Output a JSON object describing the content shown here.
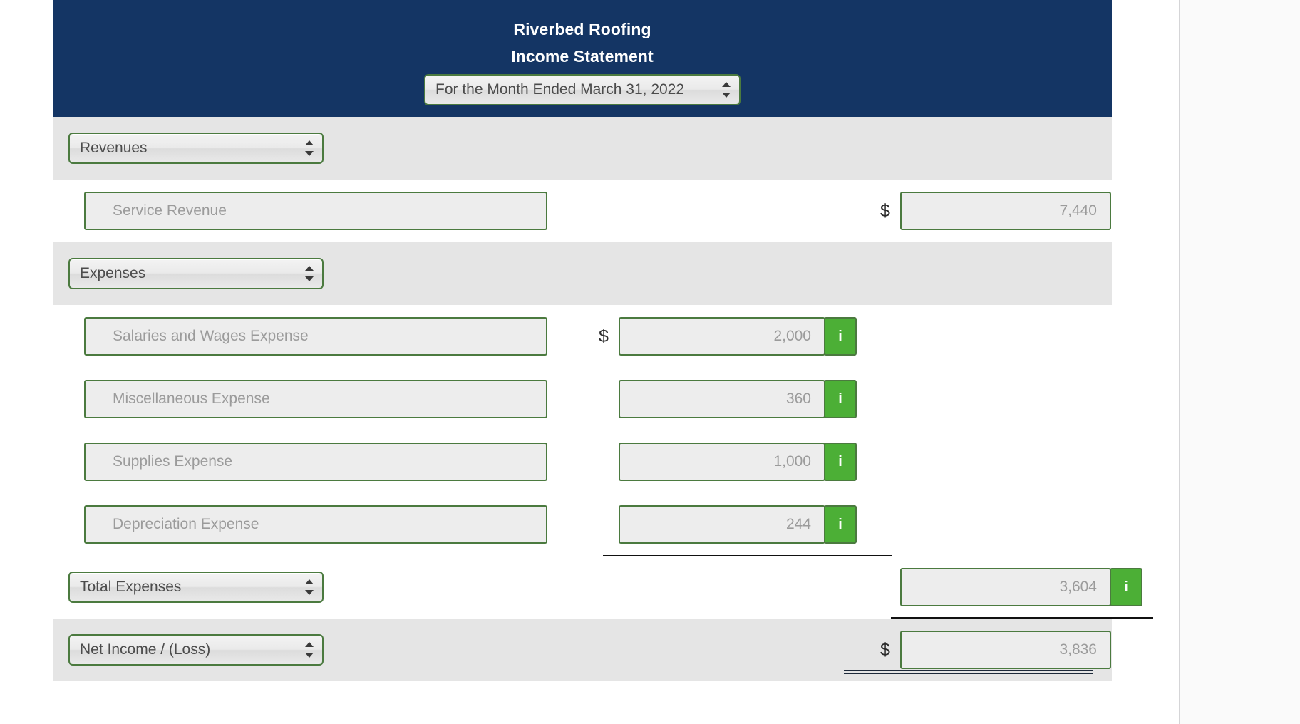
{
  "header": {
    "company": "Riverbed Roofing",
    "statement_title": "Income Statement",
    "period_select": "For the Month Ended March 31, 2022",
    "bg_color": "#143564"
  },
  "theme": {
    "header_blue": "#143564",
    "field_border_green": "#4b7a3f",
    "info_button_green": "#4caf36",
    "section_band": "#e5e5e5",
    "field_fill": "#ededed",
    "placeholder_text": "#9b9b9b"
  },
  "sections": {
    "revenues": {
      "select_label": "Revenues",
      "lines": [
        {
          "account": "Service Revenue",
          "currency": "$",
          "amount": "7,440",
          "has_info": false
        }
      ]
    },
    "expenses": {
      "select_label": "Expenses",
      "lines": [
        {
          "account": "Salaries and Wages Expense",
          "currency": "$",
          "amount": "2,000",
          "has_info": true,
          "info_label": "i"
        },
        {
          "account": "Miscellaneous Expense",
          "currency": "",
          "amount": "360",
          "has_info": true,
          "info_label": "i"
        },
        {
          "account": "Supplies Expense",
          "currency": "",
          "amount": "1,000",
          "has_info": true,
          "info_label": "i"
        },
        {
          "account": "Depreciation Expense",
          "currency": "",
          "amount": "244",
          "has_info": true,
          "info_label": "i"
        }
      ]
    }
  },
  "totals": {
    "total_expenses": {
      "select_label": "Total Expenses",
      "currency": "",
      "amount": "3,604",
      "info_label": "i"
    },
    "net_income": {
      "select_label": "Net Income / (Loss)",
      "currency": "$",
      "amount": "3,836"
    }
  }
}
